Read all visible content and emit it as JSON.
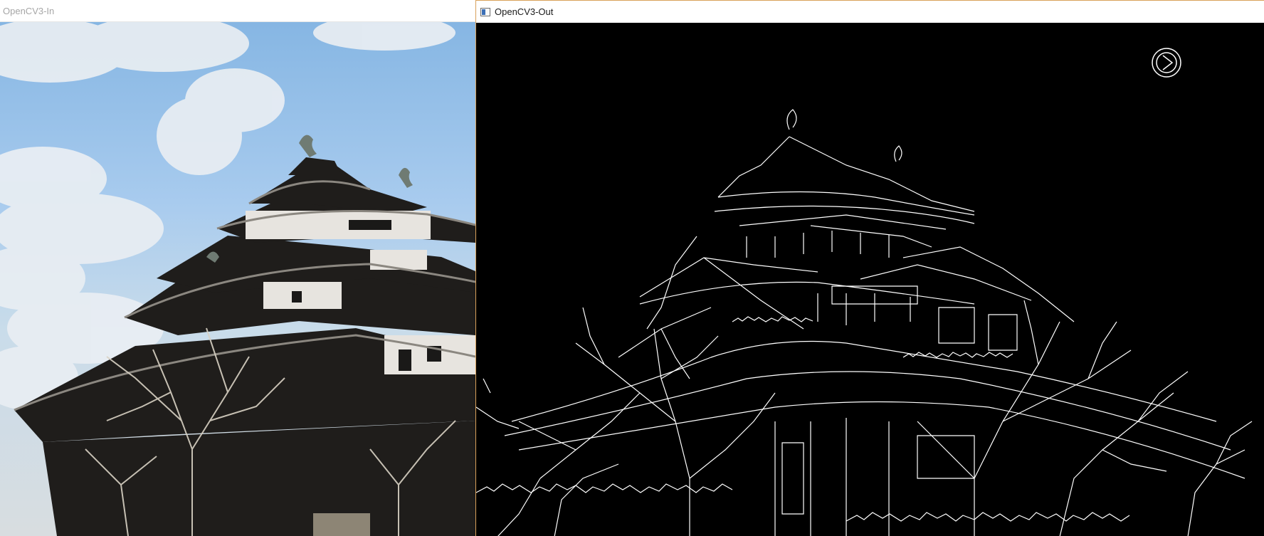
{
  "windows": {
    "input": {
      "title": "OpenCV3-In",
      "content": "castle-photo"
    },
    "output": {
      "title": "OpenCV3-Out",
      "icon": "app-window-icon",
      "content": "canny-edge-map"
    }
  },
  "colors": {
    "sky": "#8ebde8",
    "output_background": "#000000",
    "edge_lines": "#ffffff",
    "active_window_border": "#d9a15a",
    "inactive_title_text": "#a6a6a6"
  },
  "overlay": {
    "next_icon": "play-next-icon"
  }
}
